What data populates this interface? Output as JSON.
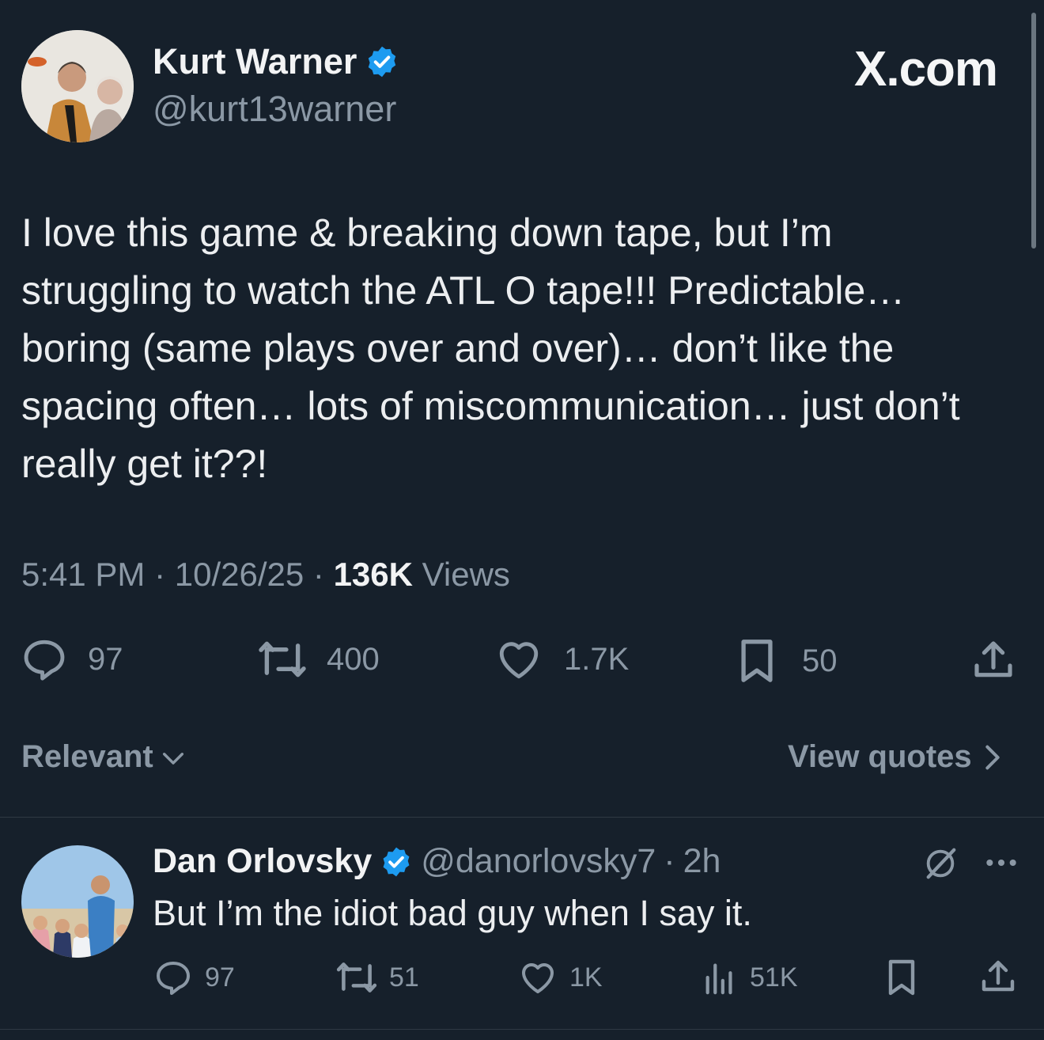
{
  "main_tweet": {
    "author_name": "Kurt Warner",
    "handle": "@kurt13warner",
    "text": "I love this game & breaking down tape, but I’m struggling to watch the ATL O tape!!! Predictable… boring (same plays over and over)… don’t like the spacing often… lots of miscommunication… just don’t really get it??!",
    "time": "5:41 PM",
    "date": "10/26/25",
    "views_count": "136K",
    "views_label": "Views",
    "replies": "97",
    "reposts": "400",
    "likes": "1.7K",
    "bookmarks": "50"
  },
  "brand": "X.com",
  "sort": {
    "label": "Relevant",
    "view_quotes": "View quotes"
  },
  "reply": {
    "author_name": "Dan Orlovsky",
    "handle": "@danorlovsky7",
    "age": "2h",
    "text": "But I’m the idiot bad guy when I say it.",
    "replies": "97",
    "reposts": "51",
    "likes": "1K",
    "views": "51K"
  },
  "colors": {
    "background": "#16202b",
    "verified": "#1d9bf0",
    "muted": "#8b98a5",
    "text": "#e7e9ea"
  },
  "icons": [
    "verified-badge-icon",
    "reply-icon",
    "repost-icon",
    "like-icon",
    "bookmark-icon",
    "share-icon",
    "views-icon",
    "grok-icon",
    "more-icon",
    "chevron-down-icon",
    "chevron-right-icon"
  ]
}
